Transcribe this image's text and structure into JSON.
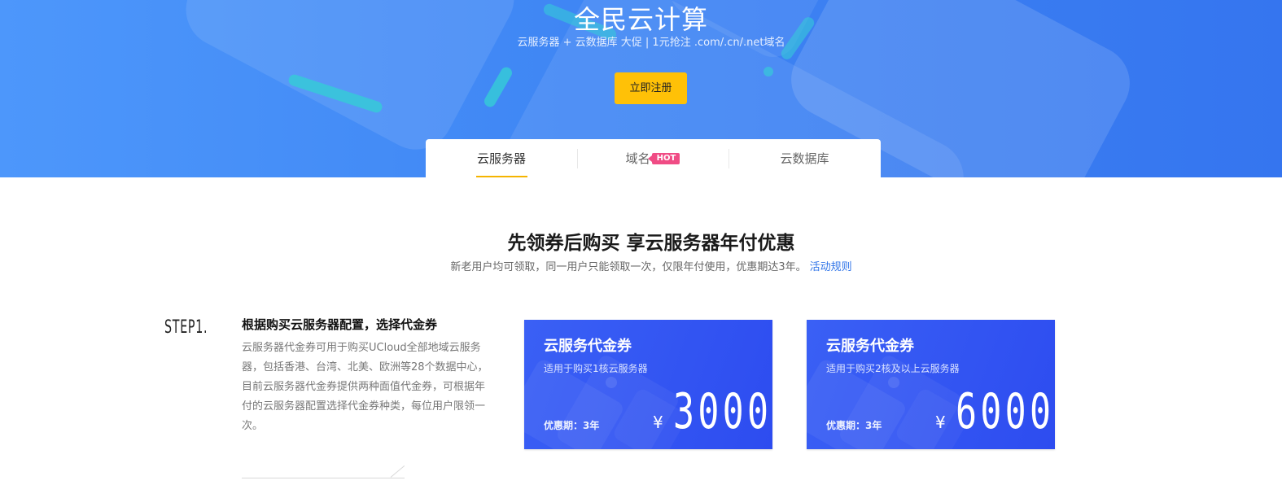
{
  "hero": {
    "title": "全民云计算",
    "subtitle": "云服务器 + 云数据库 大促 | 1元抢注 .com/.cn/.net域名",
    "cta_label": "立即注册"
  },
  "tabs": [
    {
      "label": "云服务器",
      "active": true
    },
    {
      "label": "域名",
      "badge": "HOT"
    },
    {
      "label": "云数据库"
    }
  ],
  "section": {
    "title": "先领券后购买 享云服务器年付优惠",
    "subtitle": "新老用户均可领取，同一用户只能领取一次，仅限年付使用，优惠期达3年。",
    "rules_link": "活动规则"
  },
  "step": {
    "label": "STEP1.",
    "title": "根据购买云服务器配置，选择代金券",
    "description": "云服务器代金券可用于购买UCloud全部地域云服务器，包括香港、台湾、北美、欧洲等28个数据中心，目前云服务器代金券提供两种面值代金券，可根据年付的云服务器配置选择代金券种类，每位用户限领一次。"
  },
  "coupons": [
    {
      "title": "云服务代金券",
      "desc": "适用于购买1核云服务器",
      "term": "优惠期：3年",
      "currency": "¥",
      "amount": "3000"
    },
    {
      "title": "云服务代金券",
      "desc": "适用于购买2核及以上云服务器",
      "term": "优惠期：3年",
      "currency": "¥",
      "amount": "6000"
    }
  ],
  "colors": {
    "hero_blue": "#3f86f4",
    "cta_yellow": "#ffc107",
    "coupon_blue": "#3a60f5",
    "hot_badge": "#f04c85",
    "link_blue": "#2e73e8"
  }
}
